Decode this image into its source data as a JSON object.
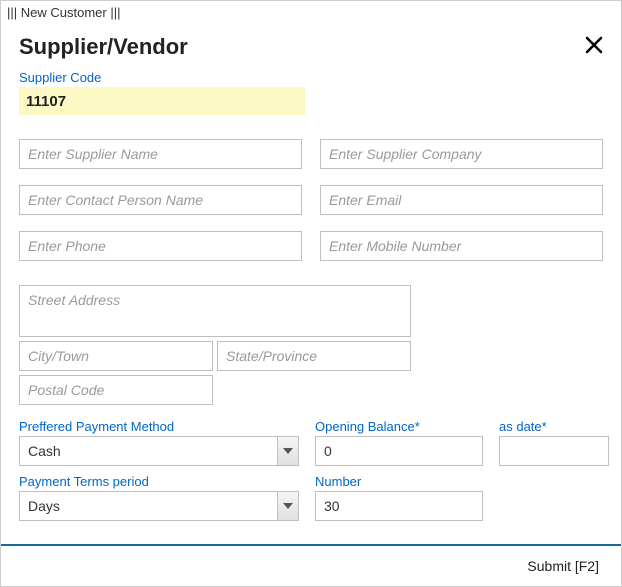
{
  "window": {
    "title": "||| New Customer |||"
  },
  "header": {
    "title": "Supplier/Vendor"
  },
  "supplier_code": {
    "label": "Supplier Code",
    "value": "11107"
  },
  "fields": {
    "supplier_name": {
      "placeholder": "Enter Supplier Name",
      "value": ""
    },
    "supplier_company": {
      "placeholder": "Enter Supplier Company",
      "value": ""
    },
    "contact_person": {
      "placeholder": "Enter Contact Person Name",
      "value": ""
    },
    "email": {
      "placeholder": "Enter Email",
      "value": ""
    },
    "phone": {
      "placeholder": "Enter Phone",
      "value": ""
    },
    "mobile": {
      "placeholder": "Enter Mobile Number",
      "value": ""
    },
    "street": {
      "placeholder": "Street Address",
      "value": ""
    },
    "city": {
      "placeholder": "City/Town",
      "value": ""
    },
    "state": {
      "placeholder": "State/Province",
      "value": ""
    },
    "postal": {
      "placeholder": "Postal Code",
      "value": ""
    }
  },
  "payment_method": {
    "label": "Preffered Payment Method",
    "value": "Cash"
  },
  "opening_balance": {
    "label": "Opening Balance*",
    "value": "0"
  },
  "as_date": {
    "label": "as date*",
    "value": ""
  },
  "payment_terms": {
    "label": "Payment Terms period",
    "value": "Days"
  },
  "number": {
    "label": "Number",
    "value": "30"
  },
  "footer": {
    "submit": "Submit [F2]"
  }
}
